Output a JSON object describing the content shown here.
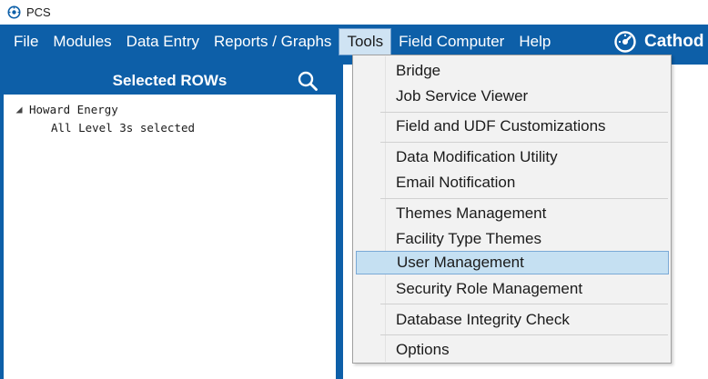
{
  "window": {
    "title": "PCS"
  },
  "menubar": {
    "items": [
      "File",
      "Modules",
      "Data Entry",
      "Reports / Graphs",
      "Tools",
      "Field Computer",
      "Help"
    ],
    "active": "Tools",
    "brand": "Cathod",
    "bg_color": "#0d5fa8"
  },
  "left_panel": {
    "title": "Selected ROWs",
    "search_icon": "search-icon",
    "tree": {
      "root": "Howard Energy",
      "child": "All Level 3s selected"
    }
  },
  "tools_menu": {
    "groups": [
      [
        "Bridge",
        "Job Service Viewer"
      ],
      [
        "Field and UDF Customizations"
      ],
      [
        "Data Modification Utility",
        "Email Notification"
      ],
      [
        "Themes Management",
        "Facility Type Themes",
        "User Management",
        "Security Role Management"
      ],
      [
        "Database Integrity Check"
      ],
      [
        "Options"
      ]
    ],
    "highlighted": "User Management",
    "highlight_color": "#c5e0f2"
  }
}
